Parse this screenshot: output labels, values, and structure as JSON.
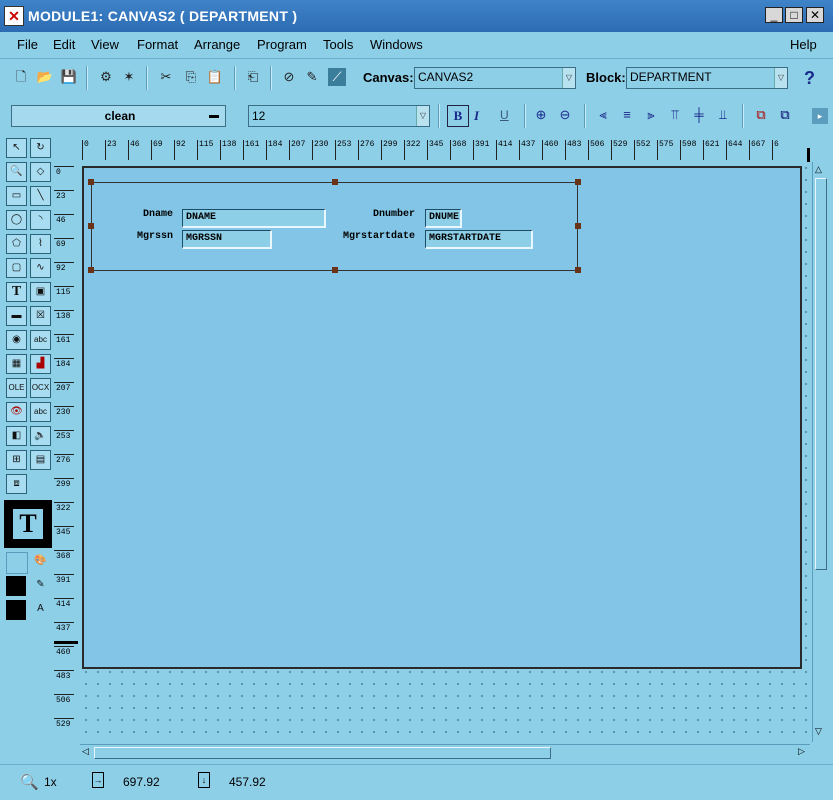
{
  "window": {
    "title": "MODULE1: CANVAS2 ( DEPARTMENT )",
    "minimize": "_",
    "maximize": "□",
    "close": "✕"
  },
  "menu": [
    "File",
    "Edit",
    "View",
    "Format",
    "Arrange",
    "Program",
    "Tools",
    "Windows"
  ],
  "help_menu": "Help",
  "toolbar1": {
    "canvas_label": "Canvas:",
    "canvas_value": "CANVAS2",
    "block_label": "Block:",
    "block_value": "DEPARTMENT",
    "help_icon": "?"
  },
  "toolbar2": {
    "font_name": "clean",
    "font_size": "12",
    "bold": "B",
    "italic": "I",
    "underline": "U"
  },
  "rulers": {
    "horizontal": [
      "0",
      "23",
      "46",
      "69",
      "92",
      "115",
      "138",
      "161",
      "184",
      "207",
      "230",
      "253",
      "276",
      "299",
      "322",
      "345",
      "368",
      "391",
      "414",
      "437",
      "460",
      "483",
      "506",
      "529",
      "552",
      "575",
      "598",
      "621",
      "644",
      "667",
      "6"
    ],
    "vertical": [
      "0",
      "23",
      "46",
      "69",
      "92",
      "115",
      "138",
      "161",
      "184",
      "207",
      "230",
      "253",
      "276",
      "299",
      "322",
      "345",
      "368",
      "391",
      "414",
      "437",
      "460",
      "483",
      "506",
      "529"
    ]
  },
  "form": {
    "dname_label": "Dname",
    "dname_value": "DNAME",
    "dnumber_label": "Dnumber",
    "dnumber_value": "DNUME",
    "mgrssn_label": "Mgrssn",
    "mgrssn_value": "MGRSSN",
    "mgrstartdate_label": "Mgrstartdate",
    "mgrstartdate_value": "MGRSTARTDATE"
  },
  "palette": {
    "text_tool": "T",
    "ole": "OLE",
    "ocx": "OCX",
    "abc": "abc"
  },
  "status": {
    "zoom": "1x",
    "x_position": "697.92",
    "y_position": "457.92"
  }
}
